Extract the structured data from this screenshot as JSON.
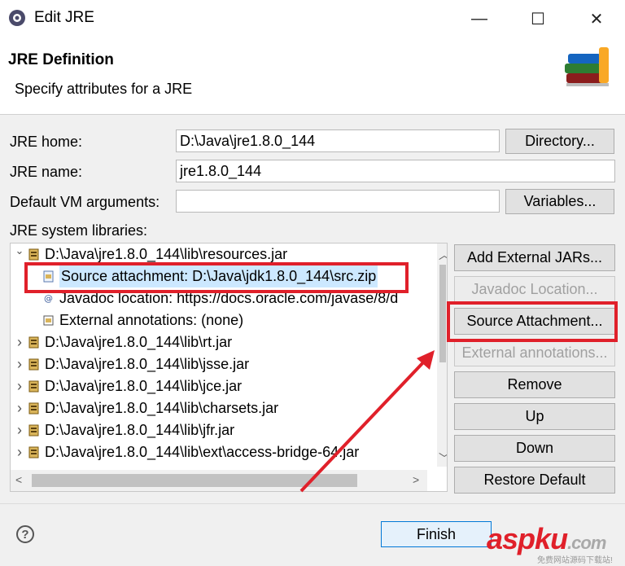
{
  "window": {
    "title": "Edit JRE",
    "minimize_glyph": "—",
    "maximize_glyph": "☐",
    "close_glyph": "✕"
  },
  "header": {
    "title": "JRE Definition",
    "description": "Specify attributes for a JRE",
    "image_icon": "books-icon"
  },
  "form": {
    "jre_home_label": "JRE home:",
    "jre_home_value": "D:\\Java\\jre1.8.0_144",
    "directory_button": "Directory...",
    "jre_name_label": "JRE name:",
    "jre_name_value": "jre1.8.0_144",
    "vm_args_label": "Default VM arguments:",
    "vm_args_value": "",
    "variables_button": "Variables...",
    "libraries_label": "JRE system libraries:"
  },
  "libraries": {
    "rows": [
      {
        "text": "D:\\Java\\jre1.8.0_144\\lib\\resources.jar",
        "level": 0,
        "expander": "v",
        "icon": "jar-icon"
      },
      {
        "text": "Source attachment: D:\\Java\\jdk1.8.0_144\\src.zip",
        "level": 1,
        "expander": "",
        "icon": "source-attachment-icon"
      },
      {
        "text": "Javadoc location: https://docs.oracle.com/javase/8/d",
        "level": 1,
        "expander": "",
        "icon": "javadoc-icon"
      },
      {
        "text": "External annotations: (none)",
        "level": 1,
        "expander": "",
        "icon": "annotations-icon"
      },
      {
        "text": "D:\\Java\\jre1.8.0_144\\lib\\rt.jar",
        "level": 0,
        "expander": ">",
        "icon": "jar-icon"
      },
      {
        "text": "D:\\Java\\jre1.8.0_144\\lib\\jsse.jar",
        "level": 0,
        "expander": ">",
        "icon": "jar-icon"
      },
      {
        "text": "D:\\Java\\jre1.8.0_144\\lib\\jce.jar",
        "level": 0,
        "expander": ">",
        "icon": "jar-icon"
      },
      {
        "text": "D:\\Java\\jre1.8.0_144\\lib\\charsets.jar",
        "level": 0,
        "expander": ">",
        "icon": "jar-icon"
      },
      {
        "text": "D:\\Java\\jre1.8.0_144\\lib\\jfr.jar",
        "level": 0,
        "expander": ">",
        "icon": "jar-icon"
      },
      {
        "text": "D:\\Java\\jre1.8.0_144\\lib\\ext\\access-bridge-64.jar",
        "level": 0,
        "expander": ">",
        "icon": "jar-icon"
      }
    ]
  },
  "side_buttons": {
    "add_external_jars": "Add External JARs...",
    "javadoc_location": "Javadoc Location...",
    "source_attachment": "Source Attachment...",
    "external_annotations": "External annotations...",
    "remove": "Remove",
    "up": "Up",
    "down": "Down",
    "restore_default": "Restore Default"
  },
  "footer": {
    "help_glyph": "?",
    "finish_button": "Finish"
  },
  "watermark": {
    "part1": "asp",
    "part2": "ku",
    "part3": ".com",
    "subtitle": "免费网站源码下载站!"
  },
  "colors": {
    "annotation_red": "#e0202a",
    "selection_blue": "#cce8ff",
    "focus_blue": "#0078d7"
  }
}
